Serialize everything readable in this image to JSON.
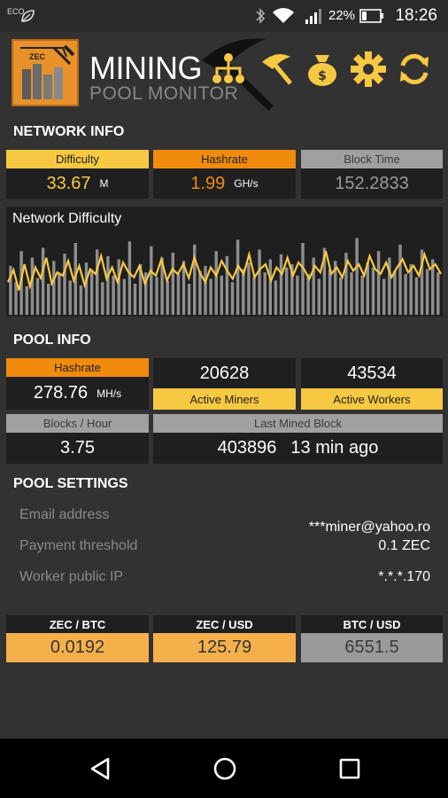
{
  "status_bar": {
    "eco_label": "ECO",
    "battery_percent": "22%",
    "time": "18:26",
    "icons": [
      "eco-leaf-icon",
      "bluetooth-icon",
      "wifi-icon",
      "signal-icon",
      "battery-icon"
    ]
  },
  "header": {
    "title": "MINING",
    "subtitle": "POOL MONITOR",
    "logo_badge": "ZEC",
    "actions": [
      "pool-network-icon",
      "pickaxe-icon",
      "money-bag-icon",
      "settings-gear-icon",
      "refresh-icon"
    ]
  },
  "network_info": {
    "section_title": "NETWORK INFO",
    "difficulty": {
      "label": "Difficulty",
      "value": "33.67",
      "unit": "M"
    },
    "hashrate": {
      "label": "Hashrate",
      "value": "1.99",
      "unit": "GH/s"
    },
    "block_time": {
      "label": "Block Time",
      "value": "152.2833"
    }
  },
  "chart": {
    "title": "Network Difficulty"
  },
  "chart_data": {
    "type": "line",
    "title": "Network Difficulty",
    "series": [],
    "line_values": [
      40,
      55,
      30,
      62,
      35,
      58,
      45,
      70,
      38,
      52,
      48,
      66,
      42,
      60,
      36,
      56,
      50,
      72,
      44,
      58,
      40,
      64,
      52,
      46,
      60,
      38,
      54,
      48,
      68,
      42,
      56,
      50,
      62,
      45,
      70,
      52,
      40,
      58,
      48,
      66,
      54,
      44,
      60,
      50,
      74,
      46,
      56,
      62,
      42,
      58,
      50,
      70,
      48,
      64,
      56,
      44,
      60,
      52,
      78,
      50,
      58,
      46,
      66,
      54,
      62,
      48,
      72,
      56,
      50,
      64,
      46,
      58,
      68,
      52,
      60,
      48,
      74,
      56,
      62,
      50
    ],
    "bar_values": [
      60,
      40,
      78,
      35,
      70,
      45,
      82,
      38,
      66,
      50,
      75,
      42,
      88,
      36,
      64,
      55,
      80,
      40,
      72,
      48,
      68,
      44,
      90,
      38,
      62,
      52,
      84,
      46,
      70,
      42,
      76,
      50,
      66,
      38,
      86,
      54,
      60,
      44,
      78,
      48,
      72,
      40,
      92,
      56,
      64,
      46,
      80,
      52,
      68,
      42,
      74,
      58,
      62,
      48,
      88,
      50,
      70,
      44,
      82,
      56,
      66,
      46,
      76,
      52,
      94,
      48,
      64,
      58,
      78,
      44,
      70,
      54,
      86,
      50,
      62,
      46,
      80,
      56,
      68,
      52
    ]
  },
  "pool_info": {
    "section_title": "POOL INFO",
    "hashrate": {
      "label": "Hashrate",
      "value": "278.76",
      "unit": "MH/s"
    },
    "active_miners": {
      "label": "Active Miners",
      "value": "20628"
    },
    "active_workers": {
      "label": "Active Workers",
      "value": "43534"
    },
    "blocks_per_hour": {
      "label": "Blocks / Hour",
      "value": "3.75"
    },
    "last_mined_block": {
      "label": "Last Mined Block",
      "block": "403896",
      "ago": "13 min ago"
    }
  },
  "pool_settings": {
    "section_title": "POOL SETTINGS",
    "email_label": "Email address",
    "email_value": "***miner@yahoo.ro",
    "threshold_label": "Payment threshold",
    "threshold_value": "0.1 ZEC",
    "ip_label": "Worker public IP",
    "ip_value": "*.*.*.170"
  },
  "rates": [
    {
      "label": "ZEC / BTC",
      "value": "0.0192",
      "color": "#f5b04c"
    },
    {
      "label": "ZEC / USD",
      "value": "125.79",
      "color": "#f5b04c"
    },
    {
      "label": "BTC / USD",
      "value": "6551.5",
      "color": "#9a9a9a"
    }
  ],
  "nav": [
    "back-icon",
    "home-icon",
    "recents-icon"
  ]
}
